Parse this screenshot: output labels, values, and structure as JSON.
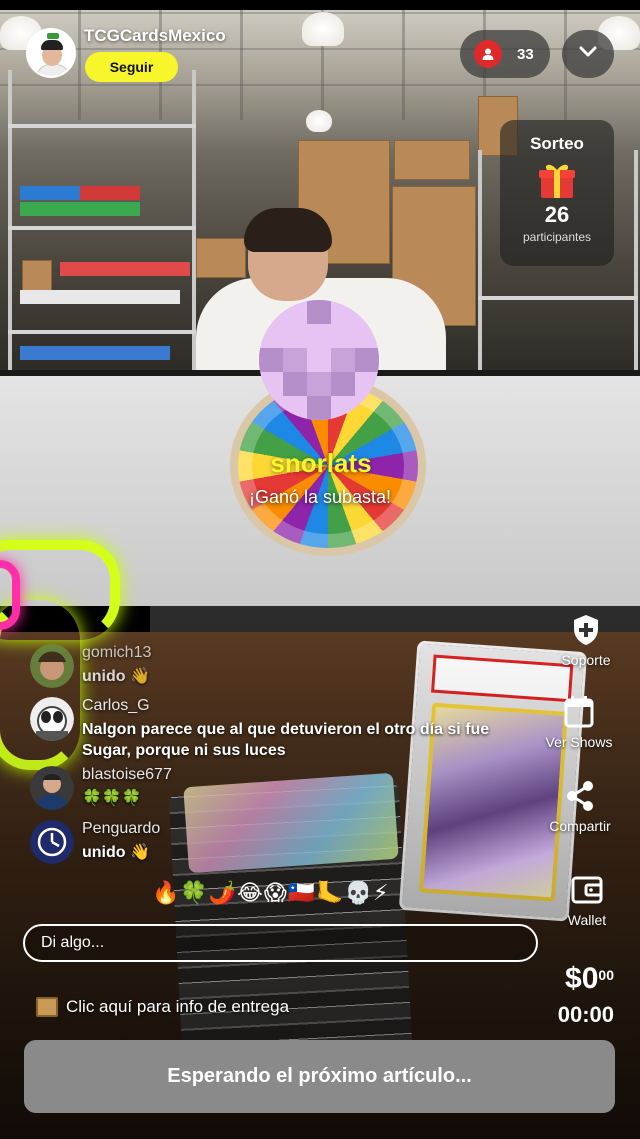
{
  "streamer": {
    "name": "TCGCardsMexico",
    "follow_label": "Seguir"
  },
  "viewers": {
    "count": "33"
  },
  "giveaway": {
    "title": "Sorteo",
    "participants_count": "26",
    "participants_label": "participantes"
  },
  "winner": {
    "name": "snorlats",
    "message": "¡Ganó la subasta!"
  },
  "side_actions": [
    {
      "label": "Soporte",
      "icon": "shield-plus-icon"
    },
    {
      "label": "Ver Shows",
      "icon": "calendar-icon"
    },
    {
      "label": "Compartir",
      "icon": "share-icon"
    },
    {
      "label": "Wallet",
      "icon": "wallet-icon"
    }
  ],
  "chat": [
    {
      "user": "gomich13",
      "text": "unido 👋"
    },
    {
      "user": "Carlos_G",
      "text": "Nalgon parece que al que detuvieron el otro día si fue Sugar, porque ni sus luces"
    },
    {
      "user": "blastoise677",
      "text": "🍀🍀🍀"
    },
    {
      "user": "Penguardo",
      "text": "unido 👋"
    }
  ],
  "emoji_reactions": "🔥🍀🌶️😂😱🇨🇱🦶💀⚡",
  "chat_input": {
    "placeholder": "Di algo..."
  },
  "delivery_info": "Clic aquí para info de entrega",
  "price": {
    "amount": "$0",
    "cents": "00"
  },
  "timer": "00:00",
  "status_button": "Esperando el próximo artículo...",
  "colors": {
    "accent_yellow": "#f6f62a",
    "viewer_badge_red": "#e02a2a",
    "status_button_gray": "#8a8a8a"
  }
}
